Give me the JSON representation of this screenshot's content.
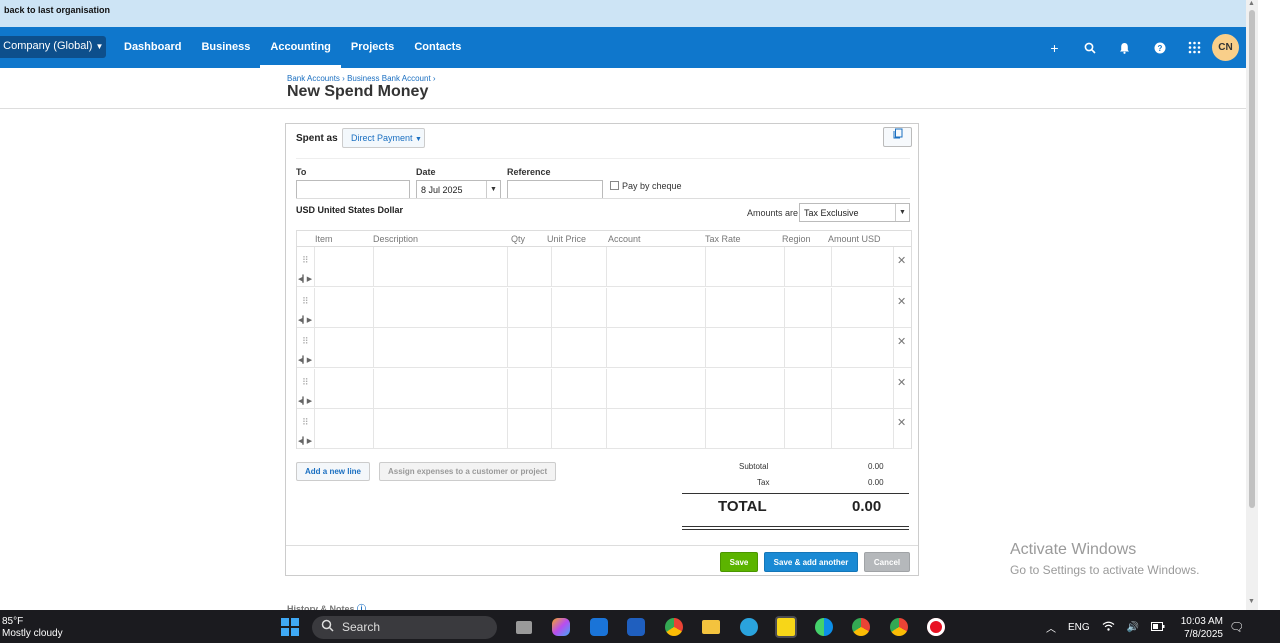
{
  "topbar": {
    "back_label": "back to last organisation"
  },
  "nav": {
    "org_label": "o Company (Global)",
    "links": [
      "Dashboard",
      "Business",
      "Accounting",
      "Projects",
      "Contacts"
    ],
    "avatar_initials": "CN",
    "accent_color": "#0f77cc"
  },
  "header": {
    "breadcrumb_1": "Bank Accounts",
    "breadcrumb_sep": "›",
    "breadcrumb_2": "Business Bank Account",
    "title": "New Spend Money"
  },
  "form": {
    "spent_as_label": "Spent as",
    "spent_as_value": "Direct Payment",
    "to_label": "To",
    "to_value": "",
    "date_label": "Date",
    "date_value": "8 Jul 2025",
    "reference_label": "Reference",
    "reference_value": "",
    "pay_by_cheque_label": "Pay by cheque",
    "currency_label": "USD United States Dollar",
    "amounts_are_label": "Amounts are",
    "amounts_are_value": "Tax Exclusive"
  },
  "lines": {
    "columns": [
      "Item",
      "Description",
      "Qty",
      "Unit Price",
      "Account",
      "Tax Rate",
      "Region",
      "Amount USD"
    ],
    "row_count": 5
  },
  "actions": {
    "add_line": "Add a new line",
    "assign": "Assign expenses to a customer or project"
  },
  "totals": {
    "subtotal_label": "Subtotal",
    "subtotal_value": "0.00",
    "tax_label": "Tax",
    "tax_value": "0.00",
    "total_label": "TOTAL",
    "total_value": "0.00"
  },
  "footer": {
    "save": "Save",
    "save_add": "Save & add another",
    "cancel": "Cancel"
  },
  "history_label": "History & Notes",
  "watermark": {
    "line1": "Activate Windows",
    "line2": "Go to Settings to activate Windows."
  },
  "taskbar": {
    "temperature": "85°F",
    "weather": "Mostly cloudy",
    "search": "Search",
    "language": "ENG",
    "time": "10:03 AM",
    "date": "7/8/2025"
  }
}
